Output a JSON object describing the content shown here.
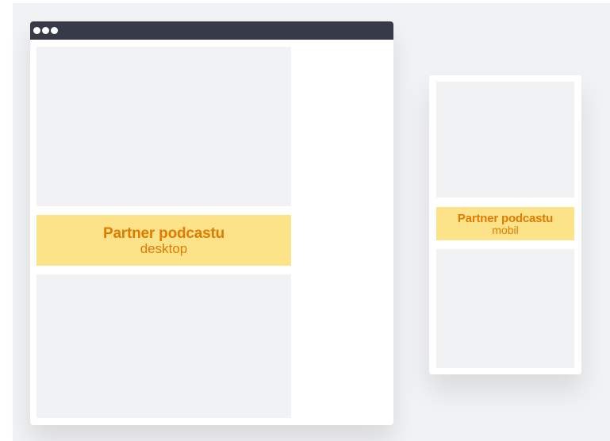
{
  "colors": {
    "background": "#f1f2f4",
    "frame": "#ffffff",
    "titlebar": "#363b47",
    "placeholder": "#f1f2f4",
    "banner_fill": "#fce389",
    "banner_text": "#e07b00"
  },
  "desktop": {
    "banner": {
      "title": "Partner podcastu",
      "subtitle": "desktop"
    }
  },
  "mobile": {
    "banner": {
      "title": "Partner podcastu",
      "subtitle": "mobil"
    }
  }
}
